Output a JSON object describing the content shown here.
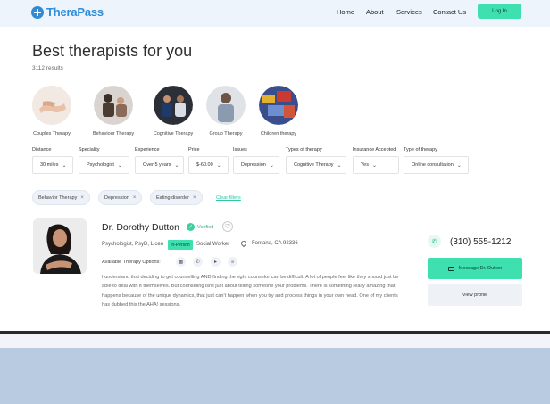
{
  "brand": {
    "name": "TheraPass",
    "color": "#2f8bd6"
  },
  "nav": {
    "links": [
      "Home",
      "About",
      "Services",
      "Contact Us"
    ],
    "login_label": "Log In",
    "accent": "#3fe0b0"
  },
  "header": {
    "title": "Best therapists for you",
    "results": "3112 results"
  },
  "categories": [
    "Couples Therapy",
    "Behaviour Therapy",
    "Cognitive Therapy",
    "Group Therapy",
    "Children therapy"
  ],
  "filters": [
    {
      "label": "Distance",
      "value": "30 miles"
    },
    {
      "label": "Speciality",
      "value": "Psychologist"
    },
    {
      "label": "Experience",
      "value": "Over 5 years"
    },
    {
      "label": "Price",
      "value": "$-60.00"
    },
    {
      "label": "Issues",
      "value": "Depression"
    },
    {
      "label": "Types of therapy",
      "value": "Cognitive Therapy"
    },
    {
      "label": "Insurance Accepted",
      "value": "Yes"
    },
    {
      "label": "Type of therapy",
      "value": "Online consultation"
    }
  ],
  "active_filters": [
    "Behavior Therapy",
    "Depression",
    "Eating disorder"
  ],
  "clear_filters_label": "Clear filters",
  "therapist": {
    "name": "Dr. Dorothy Dutton",
    "verified_label": "Verified",
    "credentials": "Psychologist, PsyD, Licen",
    "role_tail": "Social Worker",
    "inperson_tooltip": "In-Person",
    "location": "Fontana, CA 92336",
    "options_label": "Available Therapy Options:",
    "bio": "I understand that deciding to get counselling AND finding the right counselor can be difficult. A lot of people feel like they should just be able to deal with it themselves. But counseling isn't just about telling someone your problems. There is something really amazing that happens because of the unique dynamics, that just can't happen when you try and process things in your own head. One of my clients has dubbed this the AHA! sessions.",
    "phone": "(310) 555-1212",
    "message_label": "Message Dr. Dutton",
    "view_label": "View profile"
  }
}
